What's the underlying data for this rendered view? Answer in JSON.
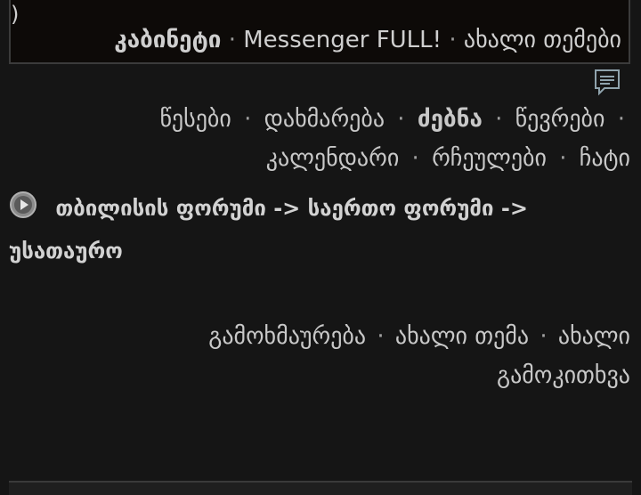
{
  "top": {
    "paren": ")",
    "cabinet": "კაბინეტი",
    "messenger": "Messenger FULL!",
    "new_topics": "ახალი თემები",
    "sep": "·"
  },
  "nav": {
    "rules": "წესები",
    "help": "დახმარება",
    "search": "ძებნა",
    "members": "წევრები",
    "calendar": "კალენდარი",
    "favorites": "რჩეულები",
    "chat": "ჩატი",
    "sep": "·"
  },
  "breadcrumb": {
    "forum": "თბილისის ფორუმი",
    "arrow1": "->",
    "general": "საერთო ფორუმი",
    "arrow2": "->",
    "untitled": "უსათაურო"
  },
  "actions": {
    "reply": "გამოხმაურება",
    "new_topic": "ახალი თემა",
    "new_poll": "ახალი გამოკითხვა",
    "sep": "·"
  },
  "icons": {
    "message": "message-icon",
    "play": "play-icon"
  }
}
